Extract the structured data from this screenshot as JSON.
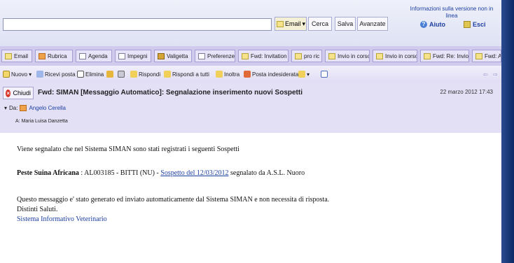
{
  "search": {
    "placeholder": "",
    "scope": "Email",
    "search_button": "Cerca",
    "save_button": "Salva",
    "advanced_button": "Avanzate"
  },
  "top_links": {
    "info": "Informazioni sulla versione non in linea",
    "help": "Aiuto",
    "exit": "Esci"
  },
  "tabs": [
    {
      "label": "Email"
    },
    {
      "label": "Rubrica"
    },
    {
      "label": "Agenda"
    },
    {
      "label": "Impegni"
    },
    {
      "label": "Valigetta"
    },
    {
      "label": "Preferenze"
    },
    {
      "label": "Fwd: Invitation"
    },
    {
      "label": "pro ric"
    },
    {
      "label": "Invio in corso"
    },
    {
      "label": "Invio in corso"
    },
    {
      "label": "Fwd: Re: Invio"
    },
    {
      "label": "Fwd: Apri"
    }
  ],
  "toolbar": {
    "new": "Nuovo",
    "receive": "Ricevi posta",
    "delete": "Elimina",
    "reply": "Rispondi",
    "reply_all": "Rispondi a tutti",
    "forward": "Inoltra",
    "junk": "Posta indesiderata"
  },
  "message": {
    "close": "Chiudi",
    "subject": "Fwd: SIMAN [Messaggio Automatico]: Segnalazione inserimento nuovi Sospetti",
    "date": "22 marzo 2012 17:43",
    "from_label": "Da:",
    "from": "Angelo Cerella",
    "to_label": "A:",
    "to": "Maria Luisa Danzetta"
  },
  "body": {
    "intro": "Viene segnalato che nel Sistema SIMAN sono stati registrati i seguenti Sospetti",
    "disease": "Peste Suina Africana",
    "detail_mid": " : AL003185 - BITTI (NU) - ",
    "suspect_link": "Sospetto del 12/03/2012",
    "detail_end": " segnalato da A.S.L. Nuoro",
    "auto_note": "Questo messaggio e' stato generato ed inviato automaticamente dal Sistema SIMAN e non necessita di risposta.",
    "greeting": "Distinti Saluti.",
    "signature": "Sistema Informativo Veterinario"
  }
}
